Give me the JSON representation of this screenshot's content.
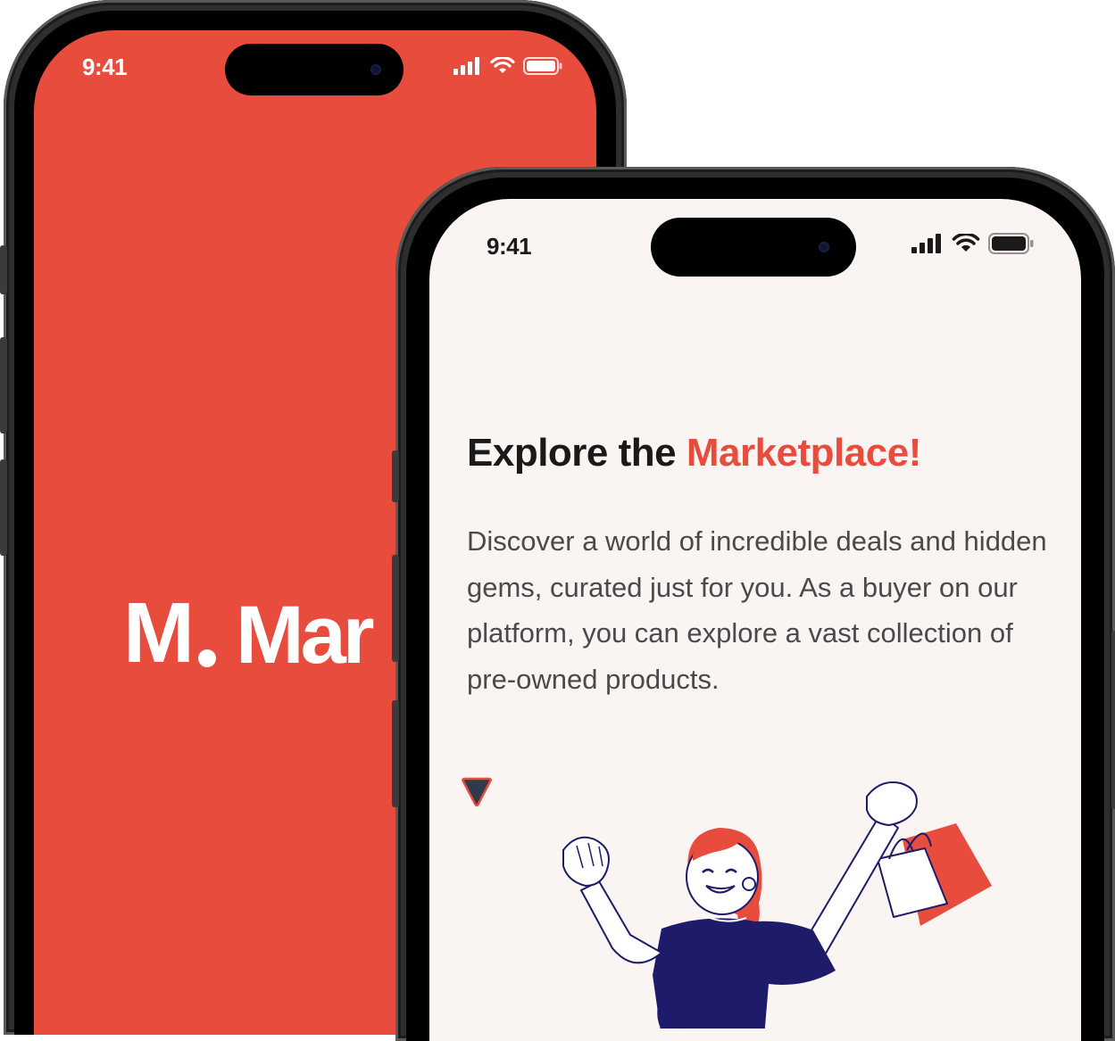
{
  "colors": {
    "brand": "#e84c3d",
    "screen_background": "#faf5f2",
    "heading": "#1a1a1a",
    "body": "#4a4a4a",
    "navy": "#1e1b6b"
  },
  "splash_screen": {
    "status_bar": {
      "time": "9:41"
    },
    "logo": {
      "mark": "M",
      "wordmark": "Mar"
    }
  },
  "onboarding_screen": {
    "status_bar": {
      "time": "9:41"
    },
    "headline": {
      "prefix": "Explore the ",
      "highlight": "Marketplace!"
    },
    "description": "Discover a world of incredible deals and hidden gems, curated just for you. As a buyer on our platform, you can explore a vast collection of pre-owned products.",
    "illustration": {
      "icon": "shopper-with-bags-illustration",
      "marker_icon": "triangle-marker-icon"
    }
  },
  "icons": {
    "signal": "cellular-signal-icon",
    "wifi": "wifi-icon",
    "battery": "battery-icon"
  }
}
